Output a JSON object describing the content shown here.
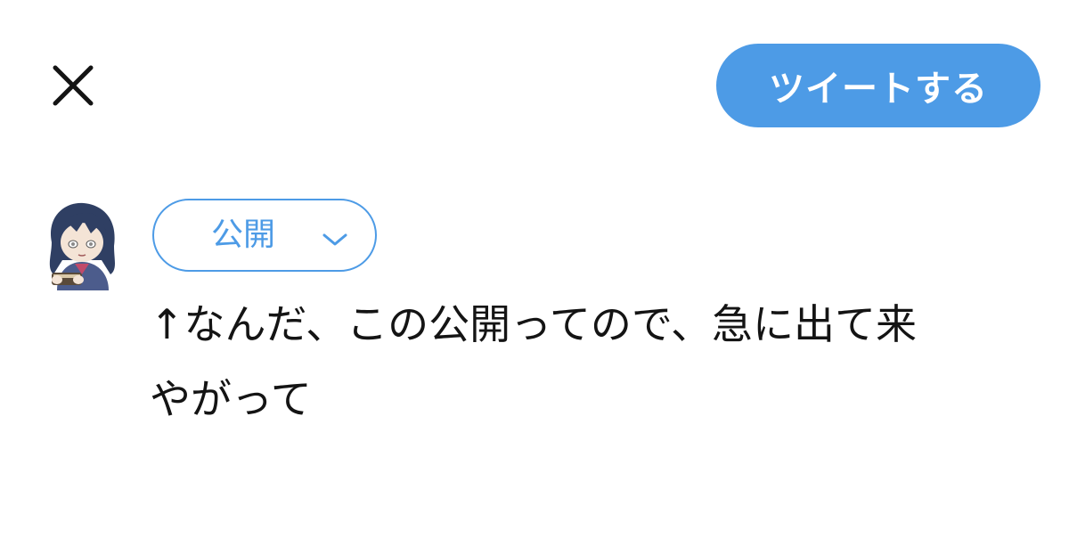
{
  "header": {
    "close_icon": "close-icon",
    "tweet_button_label": "ツイートする"
  },
  "composer": {
    "avatar_icon": "user-avatar",
    "audience_label": "公開",
    "audience_icon": "chevron-down-icon",
    "text_lines": [
      "↑なんだ、この公開ってので、急に出て来",
      "やがって"
    ]
  },
  "colors": {
    "accent": "#4d9be6",
    "text": "#141414",
    "background": "#ffffff"
  }
}
